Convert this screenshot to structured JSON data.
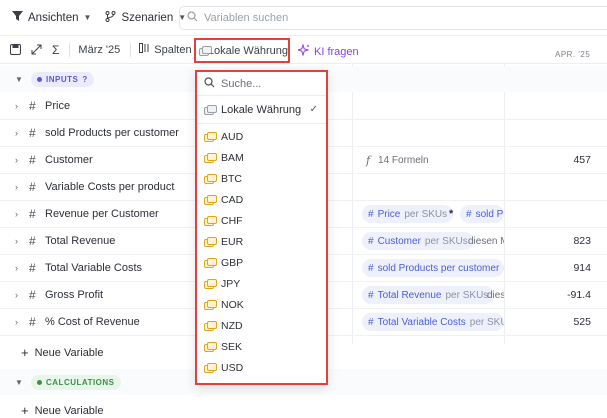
{
  "toolbar": {
    "views_label": "Ansichten",
    "scenarios_label": "Szenarien",
    "search_placeholder": "Variablen suchen"
  },
  "subbar": {
    "period_label": "März '25",
    "columns_label": "Spalten",
    "currency_label": "Lokale Währung",
    "ai_label": "KI fragen",
    "column_header": "APR. '25"
  },
  "sections": {
    "inputs_label": "INPUTS",
    "calculations_label": "CALCULATIONS",
    "add_variable_label": "Neue Variable"
  },
  "rows": [
    {
      "name": "Price",
      "formula": "",
      "value": ""
    },
    {
      "name": "sold Products per customer",
      "formula": "",
      "value": ""
    },
    {
      "name": "Customer",
      "formula": "14 Formeln",
      "value": "457"
    },
    {
      "name": "Variable Costs per product",
      "formula": "",
      "value": ""
    },
    {
      "name": "Revenue per Customer",
      "formula": "",
      "value": ""
    },
    {
      "name": "Total Revenue",
      "formula": "",
      "value": "823"
    },
    {
      "name": "Total Variable Costs",
      "formula": "",
      "value": "914"
    },
    {
      "name": "Gross Profit",
      "formula": "",
      "value": "-91.4"
    },
    {
      "name": "% Cost of Revenue",
      "formula": "",
      "value": "525"
    }
  ],
  "formulas": {
    "revenue_per_customer": {
      "chip1_name": "Price",
      "chip1_per": "per SKUs",
      "operator": "*",
      "chip2_name": "sold Pr"
    },
    "total_revenue": {
      "chip_name": "Customer",
      "chip_per": "per SKUs",
      "trailing": "diesen M"
    },
    "total_variable_costs": {
      "chip_name": "sold Products per customer",
      "chip_per": "pe"
    },
    "gross_profit": {
      "chip_name": "Total Revenue",
      "chip_per": "per SKUs",
      "trailing": "dies"
    },
    "cost_of_revenue": {
      "chip_name": "Total Variable Costs",
      "chip_per": "per SKUs"
    }
  },
  "dropdown": {
    "search_placeholder": "Suche...",
    "current": "Lokale Währung",
    "currencies": [
      "AUD",
      "BAM",
      "BTC",
      "CAD",
      "CHF",
      "EUR",
      "GBP",
      "JPY",
      "NOK",
      "NZD",
      "SEK",
      "USD"
    ]
  },
  "colors": {
    "accent_purple": "#8a3fe0",
    "highlight_red": "#e0413c",
    "chip_blue": "#4b5ed3",
    "coin_gold": "#e3a41a"
  }
}
